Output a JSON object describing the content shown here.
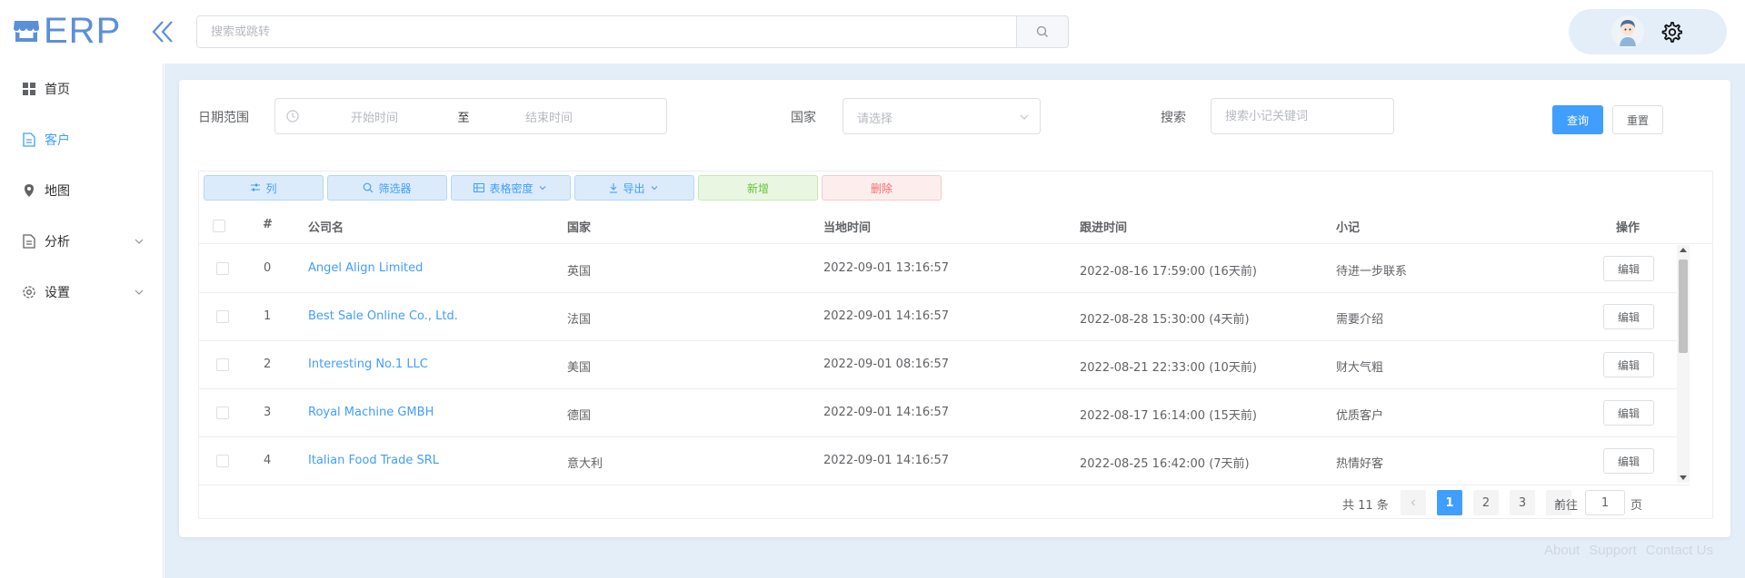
{
  "app": {
    "logo_text": "ERP",
    "colors": {
      "accent": "#409eff",
      "logo": "#5b8fd9",
      "main_bg": "#e4eef8",
      "danger": "#f56c6c",
      "success": "#67c23a"
    }
  },
  "header": {
    "search_placeholder": "搜索或跳转",
    "search_icon": "search-icon",
    "collapse_icon": "double-chevron-left-icon",
    "settings_icon": "gear-icon"
  },
  "sidebar": {
    "items": [
      {
        "label": "首页",
        "icon": "grid-icon",
        "active": false,
        "expandable": false
      },
      {
        "label": "客户",
        "icon": "document-icon",
        "active": true,
        "expandable": false
      },
      {
        "label": "地图",
        "icon": "map-pin-icon",
        "active": false,
        "expandable": false
      },
      {
        "label": "分析",
        "icon": "document-icon",
        "active": false,
        "expandable": true
      },
      {
        "label": "设置",
        "icon": "gear-icon",
        "active": false,
        "expandable": true
      }
    ]
  },
  "filters": {
    "date_label": "日期范围",
    "date_start_placeholder": "开始时间",
    "date_separator": "至",
    "date_end_placeholder": "结束时间",
    "country_label": "国家",
    "country_placeholder": "请选择",
    "search_label": "搜索",
    "search_placeholder": "搜索小记关键词",
    "query_label": "查询",
    "reset_label": "重置"
  },
  "toolbar": {
    "columns_label": "列",
    "filter_label": "筛选器",
    "density_label": "表格密度",
    "export_label": "导出",
    "add_label": "新增",
    "delete_label": "删除"
  },
  "table": {
    "headers": [
      "#",
      "公司名",
      "国家",
      "当地时间",
      "跟进时间",
      "小记",
      "操作"
    ],
    "edit_label": "编辑",
    "rows": [
      {
        "idx": "0",
        "company": "Angel Align Limited",
        "country": "英国",
        "local_time": "2022-09-01 13:16:57",
        "follow_time": "2022-08-16 17:59:00 (16天前)",
        "note": "待进一步联系"
      },
      {
        "idx": "1",
        "company": "Best Sale Online Co., Ltd.",
        "country": "法国",
        "local_time": "2022-09-01 14:16:57",
        "follow_time": "2022-08-28 15:30:00 (4天前)",
        "note": "需要介绍"
      },
      {
        "idx": "2",
        "company": "Interesting No.1 LLC",
        "country": "美国",
        "local_time": "2022-09-01 08:16:57",
        "follow_time": "2022-08-21 22:33:00 (10天前)",
        "note": "财大气粗"
      },
      {
        "idx": "3",
        "company": "Royal Machine GMBH",
        "country": "德国",
        "local_time": "2022-09-01 14:16:57",
        "follow_time": "2022-08-17 16:14:00 (15天前)",
        "note": "优质客户"
      },
      {
        "idx": "4",
        "company": "Italian Food Trade SRL",
        "country": "意大利",
        "local_time": "2022-09-01 14:16:57",
        "follow_time": "2022-08-25 16:42:00 (7天前)",
        "note": "热情好客"
      }
    ]
  },
  "pagination": {
    "total_text": "共 11 条",
    "pages": [
      "1",
      "2",
      "3"
    ],
    "current_page": "1",
    "goto_label": "前往",
    "goto_value": "1",
    "page_suffix": "页"
  },
  "footer": {
    "links": [
      "About",
      "Support",
      "Contact Us"
    ]
  }
}
